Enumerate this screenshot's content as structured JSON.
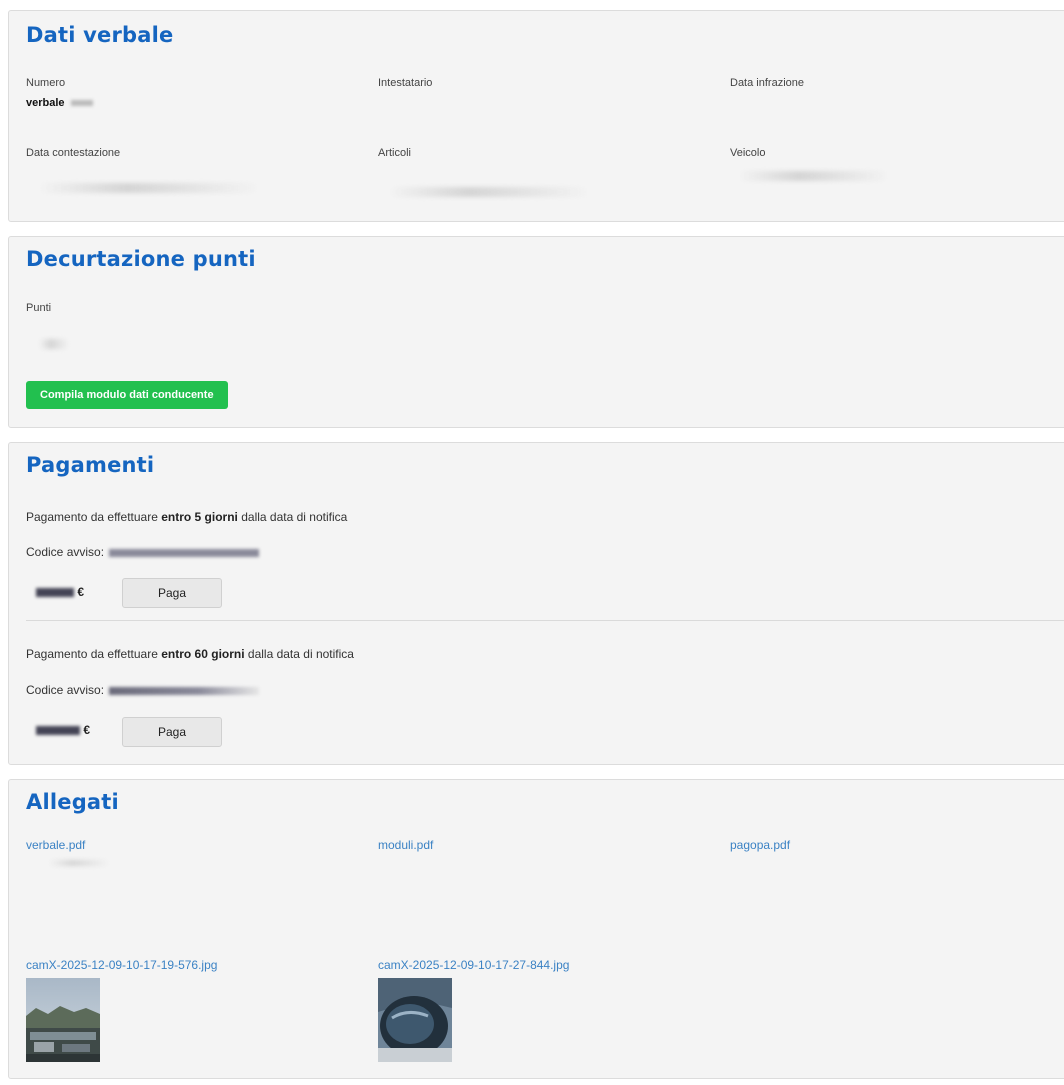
{
  "dati_verbale": {
    "title": "Dati verbale",
    "numero_label": "Numero",
    "numero_value": "verbale",
    "intestatario_label": "Intestatario",
    "data_infrazione_label": "Data infrazione",
    "data_contestazione_label": "Data contestazione",
    "articoli_label": "Articoli",
    "veicolo_label": "Veicolo"
  },
  "decurtazione": {
    "title": "Decurtazione punti",
    "punti_label": "Punti",
    "button_label": "Compila modulo dati conducente"
  },
  "pagamenti": {
    "title": "Pagamenti",
    "items": [
      {
        "prefix": "Pagamento da effettuare ",
        "deadline": "entro 5 giorni",
        "suffix": " dalla data di notifica",
        "codice_label": "Codice avviso:",
        "currency": "€",
        "button_label": "Paga"
      },
      {
        "prefix": "Pagamento da effettuare ",
        "deadline": "entro 60 giorni",
        "suffix": " dalla data di notifica",
        "codice_label": "Codice avviso:",
        "currency": "€",
        "button_label": "Paga"
      }
    ]
  },
  "allegati": {
    "title": "Allegati",
    "files": [
      "verbale.pdf",
      "moduli.pdf",
      "pagopa.pdf"
    ],
    "images": [
      "camX-2025-12-09-10-17-19-576.jpg",
      "camX-2025-12-09-10-17-27-844.jpg"
    ]
  }
}
